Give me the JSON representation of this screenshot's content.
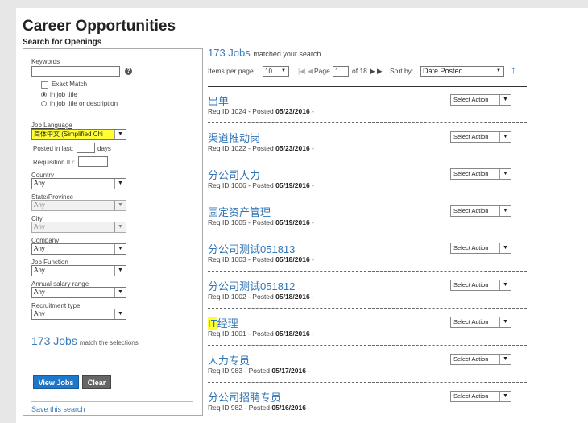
{
  "header": {
    "title": "Career Opportunities",
    "subtitle": "Search for Openings"
  },
  "search": {
    "keywords_label": "Keywords",
    "keywords_value": "",
    "help_glyph": "?",
    "exact_match_label": "Exact Match",
    "exact_match_checked": false,
    "radio_title_label": "in job title",
    "radio_desc_label": "in job title or description",
    "radio_selected": "in job title",
    "job_language_label": "Job Language",
    "job_language_value": "简体中文 (Simplified Chi",
    "posted_label": "Posted in last:",
    "posted_value": "",
    "days_label": "days",
    "requisition_label": "Requisition ID:",
    "requisition_value": "",
    "country_label": "Country",
    "country_value": "Any",
    "state_label": "State/Province",
    "state_value": "Any",
    "city_label": "City",
    "city_value": "Any",
    "company_label": "Company",
    "company_value": "Any",
    "job_function_label": "Job Function",
    "job_function_value": "Any",
    "salary_label": "Annual salary range",
    "salary_value": "Any",
    "recruitment_label": "Recruitment type",
    "recruitment_value": "Any",
    "match_count": "173 Jobs",
    "match_suffix": "match the selections",
    "view_jobs_label": "View Jobs",
    "clear_label": "Clear",
    "save_search_label": "Save this search"
  },
  "results": {
    "count": "173 Jobs",
    "count_suffix": "matched your search",
    "items_per_page_label": "Items per page",
    "items_per_page_value": "10",
    "page_label": "Page",
    "page_value": "1",
    "page_total": "of 18",
    "sort_label": "Sort by:",
    "sort_value": "Date Posted",
    "sort_arrow": "↑",
    "action_label": "Select Action",
    "jobs": [
      {
        "title": "出单",
        "req": "1024",
        "date": "05/23/2016"
      },
      {
        "title": "渠道推动岗",
        "req": "1022",
        "date": "05/23/2016"
      },
      {
        "title": "分公司人力",
        "req": "1006",
        "date": "05/19/2016"
      },
      {
        "title": "固定资产管理",
        "req": "1005",
        "date": "05/19/2016"
      },
      {
        "title": "分公司测试051813",
        "req": "1003",
        "date": "05/18/2016"
      },
      {
        "title": "分公司测试051812",
        "req": "1002",
        "date": "05/18/2016"
      },
      {
        "title": "IT经理",
        "req": "1001",
        "date": "05/18/2016"
      },
      {
        "title": "人力专员",
        "req": "983",
        "date": "05/17/2016"
      },
      {
        "title": "分公司招聘专员",
        "req": "982",
        "date": "05/16/2016"
      }
    ],
    "req_prefix": "Req ID",
    "posted_prefix": "Posted",
    "line_suffix": "-"
  },
  "colors": {
    "accent": "#2f74b5",
    "button_blue": "#1f77c9",
    "highlight": "#ffff33"
  }
}
